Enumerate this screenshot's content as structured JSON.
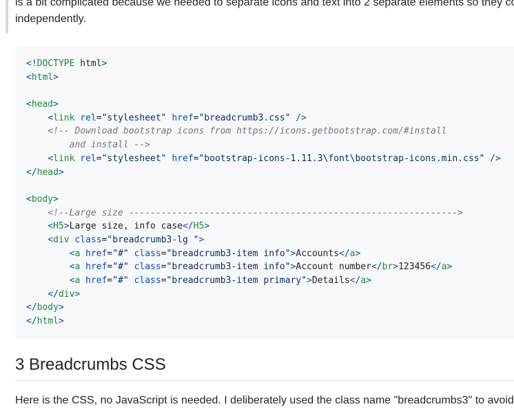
{
  "intro": {
    "line1": "is a bit complicated because we needed to separate icons and text into 2 separate elements so they co",
    "line2": "independently."
  },
  "code": {
    "lines": [
      "<!DOCTYPE html>",
      "<html>",
      "",
      "<head>",
      "    <link rel=\"stylesheet\" href=\"breadcrumb3.css\" />",
      "    <!-- Download bootstrap icons from https://icons.getbootstrap.com/#install",
      "        and install -->",
      "    <link rel=\"stylesheet\" href=\"bootstrap-icons-1.11.3\\font\\bootstrap-icons.min.css\" />",
      "</head>",
      "",
      "<body>",
      "    <!--Large size ------------------------------------------------------------->",
      "    <H5>Large size, info case</H5>",
      "    <div class=\"breadcrumb3-lg \">",
      "        <a href=\"#\" class=\"breadcrumb3-item info\">Accounts</a>",
      "        <a href=\"#\" class=\"breadcrumb3-item info\">Account number</br>123456</a>",
      "        <a href=\"#\" class=\"breadcrumb3-item primary\">Details</a>",
      "    </div>",
      "</body>",
      "</html>"
    ]
  },
  "section": {
    "heading": "3 Breadcrumbs CSS",
    "intro_text": "Here is the CSS, no JavaScript is needed. I deliberately used the class name \"breadcrumbs3\" to avoid na"
  }
}
